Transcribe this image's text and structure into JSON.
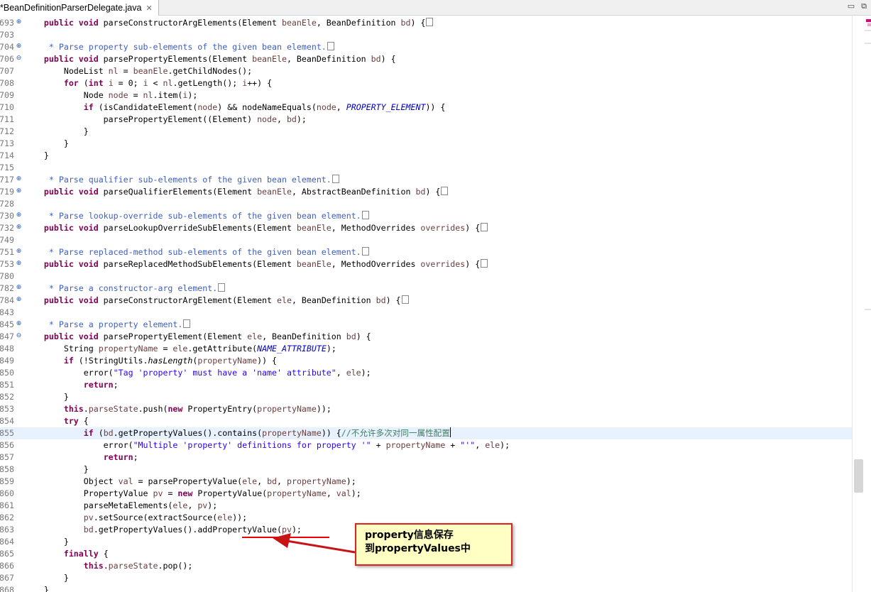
{
  "tab": {
    "title": "*BeanDefinitionParserDelegate.java"
  },
  "lines": [
    {
      "num": "693",
      "fold": "plus",
      "html": "    <span class=\"kw\">public void</span> parseConstructorArgElements(Element <span class=\"var\">beanEle</span>, BeanDefinition <span class=\"var\">bd</span>) {<span class=\"box\"></span>"
    },
    {
      "num": "703",
      "html": ""
    },
    {
      "num": "704",
      "fold": "plus",
      "html": "     <span class=\"cm\">* Parse property sub-elements of the given bean element.</span><span class=\"box\"></span>"
    },
    {
      "num": "706",
      "fold": "minus",
      "html": "    <span class=\"kw\">public void</span> parsePropertyElements(Element <span class=\"var\">beanEle</span>, BeanDefinition <span class=\"var\">bd</span>) {"
    },
    {
      "num": "707",
      "html": "        NodeList <span class=\"var\">nl</span> = <span class=\"var\">beanEle</span>.getChildNodes();"
    },
    {
      "num": "708",
      "html": "        <span class=\"kw\">for</span> (<span class=\"kw\">int</span> <span class=\"var\">i</span> = 0; <span class=\"var\">i</span> &lt; <span class=\"var\">nl</span>.getLength(); <span class=\"var\">i</span>++) {"
    },
    {
      "num": "709",
      "html": "            Node <span class=\"var\">node</span> = <span class=\"var\">nl</span>.item(<span class=\"var\">i</span>);"
    },
    {
      "num": "710",
      "html": "            <span class=\"kw\">if</span> (isCandidateElement(<span class=\"var\">node</span>) &amp;&amp; nodeNameEquals(<span class=\"var\">node</span>, <span class=\"fld\">PROPERTY_ELEMENT</span>)) {"
    },
    {
      "num": "711",
      "html": "                parsePropertyElement((Element) <span class=\"var\">node</span>, <span class=\"var\">bd</span>);"
    },
    {
      "num": "712",
      "html": "            }"
    },
    {
      "num": "713",
      "html": "        }"
    },
    {
      "num": "714",
      "html": "    }"
    },
    {
      "num": "715",
      "html": ""
    },
    {
      "num": "717",
      "fold": "plus",
      "html": "     <span class=\"cm\">* Parse qualifier sub-elements of the given bean element.</span><span class=\"box\"></span>"
    },
    {
      "num": "719",
      "fold": "plus",
      "html": "    <span class=\"kw\">public void</span> parseQualifierElements(Element <span class=\"var\">beanEle</span>, AbstractBeanDefinition <span class=\"var\">bd</span>) {<span class=\"box\"></span>"
    },
    {
      "num": "728",
      "html": ""
    },
    {
      "num": "730",
      "fold": "plus",
      "html": "     <span class=\"cm\">* Parse lookup-override sub-elements of the given bean element.</span><span class=\"box\"></span>"
    },
    {
      "num": "732",
      "fold": "plus",
      "html": "    <span class=\"kw\">public void</span> parseLookupOverrideSubElements(Element <span class=\"var\">beanEle</span>, MethodOverrides <span class=\"var\">overrides</span>) {<span class=\"box\"></span>"
    },
    {
      "num": "749",
      "html": ""
    },
    {
      "num": "751",
      "fold": "plus",
      "html": "     <span class=\"cm\">* Parse replaced-method sub-elements of the given bean element.</span><span class=\"box\"></span>"
    },
    {
      "num": "753",
      "fold": "plus",
      "html": "    <span class=\"kw\">public void</span> parseReplacedMethodSubElements(Element <span class=\"var\">beanEle</span>, MethodOverrides <span class=\"var\">overrides</span>) {<span class=\"box\"></span>"
    },
    {
      "num": "780",
      "html": ""
    },
    {
      "num": "782",
      "fold": "plus",
      "html": "     <span class=\"cm\">* Parse a constructor-arg element.</span><span class=\"box\"></span>"
    },
    {
      "num": "784",
      "fold": "plus",
      "html": "    <span class=\"kw\">public void</span> parseConstructorArgElement(Element <span class=\"var\">ele</span>, BeanDefinition <span class=\"var\">bd</span>) {<span class=\"box\"></span>"
    },
    {
      "num": "843",
      "html": ""
    },
    {
      "num": "845",
      "fold": "plus",
      "html": "     <span class=\"cm\">* Parse a property element.</span><span class=\"box\"></span>"
    },
    {
      "num": "847",
      "fold": "minus",
      "html": "    <span class=\"kw\">public void</span> parsePropertyElement(Element <span class=\"var\">ele</span>, BeanDefinition <span class=\"var\">bd</span>) {"
    },
    {
      "num": "848",
      "html": "        String <span class=\"var\">propertyName</span> = <span class=\"var\">ele</span>.getAttribute(<span class=\"fld\">NAME_ATTRIBUTE</span>);"
    },
    {
      "num": "849",
      "html": "        <span class=\"kw\">if</span> (!StringUtils.<span class=\"it\">hasLength</span>(<span class=\"var\">propertyName</span>)) {"
    },
    {
      "num": "850",
      "html": "            error(<span class=\"str\">\"Tag 'property' must have a 'name' attribute\"</span>, <span class=\"var\">ele</span>);"
    },
    {
      "num": "851",
      "html": "            <span class=\"kw\">return</span>;"
    },
    {
      "num": "852",
      "html": "        }"
    },
    {
      "num": "853",
      "html": "        <span class=\"kw\">this</span>.<span class=\"var\">parseState</span>.push(<span class=\"kw\">new</span> PropertyEntry(<span class=\"var\">propertyName</span>));"
    },
    {
      "num": "854",
      "html": "        <span class=\"kw\">try</span> {"
    },
    {
      "num": "855",
      "current": true,
      "html": "            <span class=\"kw\">if</span> (<span class=\"var\">bd</span>.getPropertyValues().contains(<span class=\"var\">propertyName</span>)) {<span class=\"lc\">//不允许多次对同一属性配置</span><span class=\"caret\"></span>"
    },
    {
      "num": "856",
      "html": "                error(<span class=\"str\">\"Multiple 'property' definitions for property '\"</span> + <span class=\"var\">propertyName</span> + <span class=\"str\">\"'\"</span>, <span class=\"var\">ele</span>);"
    },
    {
      "num": "857",
      "html": "                <span class=\"kw\">return</span>;"
    },
    {
      "num": "858",
      "html": "            }"
    },
    {
      "num": "859",
      "html": "            Object <span class=\"var\">val</span> = parsePropertyValue(<span class=\"var\">ele</span>, <span class=\"var\">bd</span>, <span class=\"var\">propertyName</span>);"
    },
    {
      "num": "860",
      "html": "            PropertyValue <span class=\"var\">pv</span> = <span class=\"kw\">new</span> PropertyValue(<span class=\"var\">propertyName</span>, <span class=\"var\">val</span>);"
    },
    {
      "num": "861",
      "html": "            parseMetaElements(<span class=\"var\">ele</span>, <span class=\"var\">pv</span>);"
    },
    {
      "num": "862",
      "html": "            <span class=\"var\">pv</span>.setSource(extractSource(<span class=\"var\">ele</span>));"
    },
    {
      "num": "863",
      "html": "            <span class=\"var\">bd</span>.getPropertyValues().addPropertyValue(<span class=\"var\">pv</span>);"
    },
    {
      "num": "864",
      "html": "        }"
    },
    {
      "num": "865",
      "html": "        <span class=\"kw\">finally</span> {"
    },
    {
      "num": "866",
      "html": "            <span class=\"kw\">this</span>.<span class=\"var\">parseState</span>.pop();"
    },
    {
      "num": "867",
      "html": "        }"
    },
    {
      "num": "868",
      "html": "    }"
    }
  ],
  "callout": {
    "line1": "property信息保存",
    "line2": "到propertyValues中"
  },
  "colors": {
    "callout_border": "#dd2222",
    "callout_bg": "#ffffc4",
    "arrow": "#dd1111"
  }
}
